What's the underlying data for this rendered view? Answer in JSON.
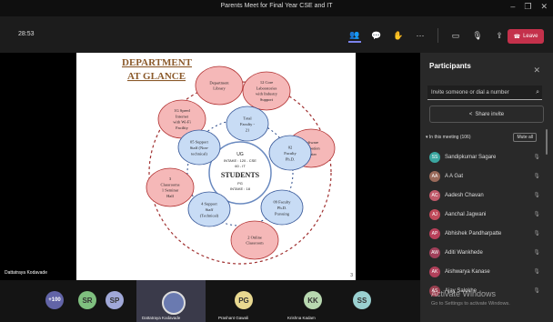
{
  "window": {
    "title": "Parents Meet for Final Year CSE and IT"
  },
  "toolbar": {
    "timer": "28:53",
    "leave_label": "Leave"
  },
  "stage": {
    "presenter_name": "Dattatraya Kodavade",
    "page_number": "3",
    "slide": {
      "heading_line1": "DEPARTMENT",
      "heading_line2": "AT GLANCE",
      "center_line1": "UG",
      "center_line2": "INTAKE : 120 - CSE",
      "center_line3": "60 - IT",
      "center_line4": "STUDENTS",
      "center_line5": "PG",
      "center_line6": "INTAKE : 18",
      "bubbles": [
        {
          "l1": "Department",
          "l2": "Library",
          "l3": "",
          "l4": "",
          "l5": ""
        },
        {
          "l1": "12 Core",
          "l2": "Laboratories",
          "l3": "with Industry",
          "l4": "Support",
          "l5": ""
        },
        {
          "l1": "Software",
          "l2": "Incubation",
          "l3": "Center",
          "l4": "",
          "l5": ""
        },
        {
          "l1": "2 Online",
          "l2": "Classroom",
          "l3": "",
          "l4": "",
          "l5": ""
        },
        {
          "l1": "3",
          "l2": "Classrooms",
          "l3": "1 Seminar",
          "l4": "Hall",
          "l5": ""
        },
        {
          "l1": "1G Speed",
          "l2": "Internet",
          "l3": "with Wi-Fi",
          "l4": "Facility",
          "l5": ""
        }
      ],
      "inner": [
        {
          "l1": "Total",
          "l2": "Faculty -",
          "l3": "21"
        },
        {
          "l1": "02",
          "l2": "Faculty",
          "l3": "Ph.D."
        },
        {
          "l1": "09 Faculty",
          "l2": "Ph.D.",
          "l3": "Pursuing"
        },
        {
          "l1": "4 Support",
          "l2": "Staff",
          "l3": "(Technical)"
        },
        {
          "l1": "05 Support",
          "l2": "Staff (Non-",
          "l3": "technical)"
        }
      ]
    }
  },
  "panel": {
    "title": "Participants",
    "invite_placeholder": "Invite someone or dial a number",
    "share_label": "Share invite",
    "meeting_label": "In this meeting (106)",
    "mute_all": "Mute all",
    "participants": [
      {
        "initials": "SS",
        "name": "Sandipkumar Sagare",
        "color": "#3aa6a0"
      },
      {
        "initials": "AA",
        "name": "A A Gat",
        "color": "#9a6a5a"
      },
      {
        "initials": "AC",
        "name": "Aadesh Chavan",
        "color": "#c05a6a"
      },
      {
        "initials": "AJ",
        "name": "Aanchal Jagwani",
        "color": "#c04a5a"
      },
      {
        "initials": "AP",
        "name": "Abhishek Pandharpatte",
        "color": "#b8405a"
      },
      {
        "initials": "AW",
        "name": "Aditi Wankhede",
        "color": "#a0405a"
      },
      {
        "initials": "AK",
        "name": "Aishwarya Kanase",
        "color": "#b0405a"
      },
      {
        "initials": "AS",
        "name": "Ajay Salokhe",
        "color": "#9a4050"
      }
    ]
  },
  "bottom": {
    "more_count": "+100",
    "tiles": [
      {
        "initials": "SR",
        "name": "",
        "color": "#7fbf7f"
      },
      {
        "initials": "SP",
        "name": "",
        "color": "#a0a8d8"
      },
      {
        "initials": "",
        "name": "Dattatraya Kodavade",
        "color": "#6a7ab0"
      },
      {
        "initials": "PG",
        "name": "Prashant Gawali",
        "color": "#e8d890"
      },
      {
        "initials": "KK",
        "name": "Krishna Kadam",
        "color": "#b8d8b0"
      },
      {
        "initials": "SS",
        "name": "",
        "color": "#9ad0d0"
      }
    ]
  },
  "watermark": {
    "line1": "Activate Windows",
    "line2": "Go to Settings to activate Windows."
  }
}
